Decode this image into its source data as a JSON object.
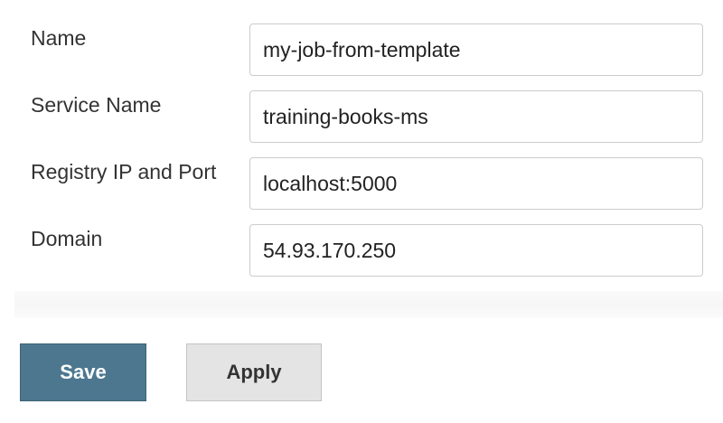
{
  "form": {
    "fields": [
      {
        "label": "Name",
        "value": "my-job-from-template"
      },
      {
        "label": "Service Name",
        "value": "training-books-ms"
      },
      {
        "label": "Registry IP and Port",
        "value": "localhost:5000"
      },
      {
        "label": "Domain",
        "value": "54.93.170.250"
      }
    ]
  },
  "buttons": {
    "save_label": "Save",
    "apply_label": "Apply"
  },
  "colors": {
    "save_button_bg": "#4c778f",
    "apply_button_bg": "#e4e4e4",
    "label_text": "#333333",
    "input_border": "#cccccc"
  }
}
